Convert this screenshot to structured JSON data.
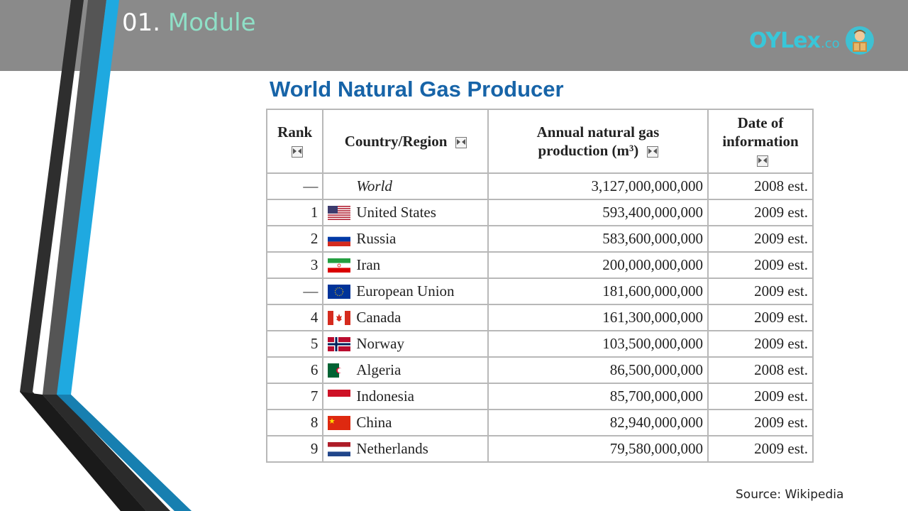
{
  "header": {
    "number": "01.",
    "module": "Module"
  },
  "logo": {
    "text": "OYLex",
    "suffix": ".co",
    "avatar_icon": "reader-avatar-icon"
  },
  "title": "World Natural Gas Producer",
  "table": {
    "columns": [
      "Rank",
      "Country/Region",
      "Annual natural gas production (m³)",
      "Date of information"
    ],
    "rows": [
      {
        "rank": "—",
        "country": "World",
        "production": "3,127,000,000,000",
        "date": "2008 est.",
        "flag": "none"
      },
      {
        "rank": "1",
        "country": "United States",
        "production": "593,400,000,000",
        "date": "2009 est.",
        "flag": "us"
      },
      {
        "rank": "2",
        "country": "Russia",
        "production": "583,600,000,000",
        "date": "2009 est.",
        "flag": "ru"
      },
      {
        "rank": "3",
        "country": "Iran",
        "production": "200,000,000,000",
        "date": "2009 est.",
        "flag": "ir"
      },
      {
        "rank": "—",
        "country": "European Union",
        "production": "181,600,000,000",
        "date": "2009 est.",
        "flag": "eu"
      },
      {
        "rank": "4",
        "country": "Canada",
        "production": "161,300,000,000",
        "date": "2009 est.",
        "flag": "ca"
      },
      {
        "rank": "5",
        "country": "Norway",
        "production": "103,500,000,000",
        "date": "2009 est.",
        "flag": "no"
      },
      {
        "rank": "6",
        "country": "Algeria",
        "production": "86,500,000,000",
        "date": "2008 est.",
        "flag": "dz"
      },
      {
        "rank": "7",
        "country": "Indonesia",
        "production": "85,700,000,000",
        "date": "2009 est.",
        "flag": "id"
      },
      {
        "rank": "8",
        "country": "China",
        "production": "82,940,000,000",
        "date": "2009 est.",
        "flag": "cn"
      },
      {
        "rank": "9",
        "country": "Netherlands",
        "production": "79,580,000,000",
        "date": "2009 est.",
        "flag": "nl"
      }
    ]
  },
  "source": "Source: Wikipedia",
  "colors": {
    "header_bg": "#8a8a8a",
    "module_accent": "#8fe0c7",
    "title_blue": "#1764a8",
    "logo_cyan": "#39c6d8"
  }
}
